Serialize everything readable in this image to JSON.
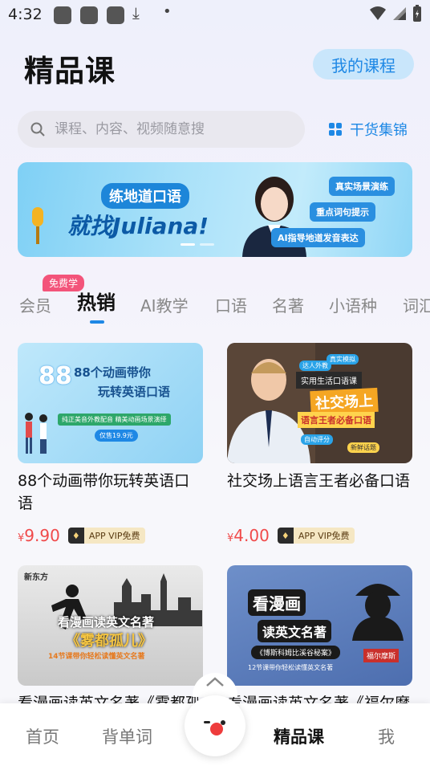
{
  "status_bar": {
    "time": "4:32"
  },
  "header": {
    "title": "精品课",
    "my_courses": "我的课程"
  },
  "search": {
    "placeholder": "课程、内容、视频随意搜",
    "goods_link": "干货集锦"
  },
  "banner": {
    "line1": "练地道口语",
    "line2": "就找Juliana!",
    "tags": [
      "真实场景演练",
      "重点词句提示",
      "AI指导地道发音表达"
    ]
  },
  "tabs": {
    "free_badge": "免费学",
    "items": [
      "会员",
      "热销",
      "AI教学",
      "口语",
      "名著",
      "小语种",
      "词汇"
    ],
    "active_index": 1
  },
  "courses": [
    {
      "title": "88个动画带你玩转英语口语",
      "price_symbol": "¥",
      "price": "9.90",
      "badge": "APP VIP免费",
      "cover_line1": "88个动画带你",
      "cover_line2": "玩转英语口语",
      "cover_sub": "纯正美音外教配音  精美动画场景演绎",
      "cover_price": "仅售19.9元"
    },
    {
      "title": "社交场上语言王者必备口语",
      "price_symbol": "¥",
      "price": "4.00",
      "badge": "APP VIP免费",
      "cover_line1": "实用生活口语课",
      "cover_line2": "社交场上",
      "cover_line3": "语言王者必备口语",
      "cover_tags": [
        "真实模拟",
        "达人外教",
        "自动评分",
        "新鲜话题"
      ]
    },
    {
      "title": "看漫画读英文名著《雾都孤儿》",
      "cover_brand": "新东方",
      "cover_line1": "看漫画读英文名著",
      "cover_line2": "《雾都孤儿》",
      "cover_sub": "14节课带你轻松读懂英文名著"
    },
    {
      "title": "看漫画读英文名著《福尔摩斯》",
      "cover_line1": "看漫画",
      "cover_line2": "读英文名著",
      "cover_sub": "《博斯科姆比溪谷秘案》",
      "cover_sub2": "12节课带你轻松读懂英文名著",
      "cover_tag": "福尔摩斯"
    }
  ],
  "bottom_nav": {
    "items": [
      "首页",
      "背单词",
      "精品课",
      "我"
    ],
    "active_index": 2
  },
  "colors": {
    "accent": "#1e88e5",
    "price": "#f04a4a",
    "badge_pink": "#f3547a"
  }
}
